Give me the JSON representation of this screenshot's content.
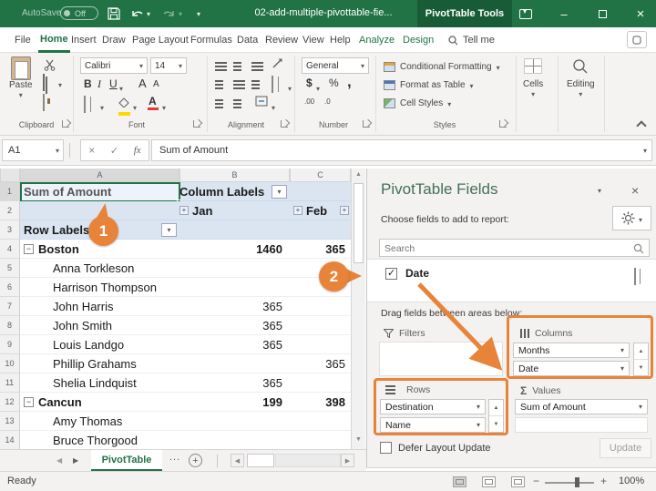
{
  "colors": {
    "excel_green": "#217346",
    "dark_green": "#185c37",
    "orange": "#e8833a",
    "header_blue": "#dbe5f1"
  },
  "titlebar": {
    "autosave_label": "AutoSave",
    "autosave_state": "Off",
    "filename": "02-add-multiple-pivottable-fie...",
    "context_tool": "PivotTable Tools"
  },
  "ribbon": {
    "tabs": [
      {
        "label": "File"
      },
      {
        "label": "Home",
        "active": true
      },
      {
        "label": "Insert"
      },
      {
        "label": "Draw"
      },
      {
        "label": "Page Layout"
      },
      {
        "label": "Formulas"
      },
      {
        "label": "Data"
      },
      {
        "label": "Review"
      },
      {
        "label": "View"
      },
      {
        "label": "Help"
      },
      {
        "label": "Analyze",
        "contextual": true
      },
      {
        "label": "Design",
        "contextual": true
      }
    ],
    "tell_me": "Tell me",
    "paste": "Paste",
    "font_name": "Calibri",
    "font_size": "14",
    "bold": "B",
    "italic": "I",
    "underline": "U",
    "grow_font": "A",
    "shrink_font": "A",
    "font_color_a": "A",
    "number_format": "General",
    "currency": "$",
    "percent": "%",
    "comma": ",",
    "inc_decimal": ".00",
    "dec_decimal": ".0",
    "cond_fmt": "Conditional Formatting",
    "fmt_table": "Format as Table",
    "cell_styles": "Cell Styles",
    "cells": "Cells",
    "editing": "Editing",
    "group_clipboard": "Clipboard",
    "group_font": "Font",
    "group_alignment": "Alignment",
    "group_number": "Number",
    "group_styles": "Styles"
  },
  "formula_bar": {
    "name_box": "A1",
    "fx": "fx",
    "value": "Sum of Amount"
  },
  "sheet": {
    "columns": [
      "A",
      "B",
      "C"
    ],
    "rows": [
      {
        "n": "1",
        "a": "Sum of Amount",
        "b": "Column Labels",
        "c": ""
      },
      {
        "n": "2",
        "a": "",
        "b": "Jan",
        "c": "Feb"
      },
      {
        "n": "3",
        "a": "Row Labels",
        "b": "",
        "c": ""
      },
      {
        "n": "4",
        "a": "Boston",
        "b": "1460",
        "c": "365"
      },
      {
        "n": "5",
        "a": "Anna Torkleson",
        "b": "",
        "c": ""
      },
      {
        "n": "6",
        "a": "Harrison Thompson",
        "b": "",
        "c": ""
      },
      {
        "n": "7",
        "a": "John Harris",
        "b": "365",
        "c": ""
      },
      {
        "n": "8",
        "a": "John Smith",
        "b": "365",
        "c": ""
      },
      {
        "n": "9",
        "a": "Louis Landgo",
        "b": "365",
        "c": ""
      },
      {
        "n": "10",
        "a": "Phillip Grahams",
        "b": "",
        "c": "365"
      },
      {
        "n": "11",
        "a": "Shelia Lindquist",
        "b": "365",
        "c": ""
      },
      {
        "n": "12",
        "a": "Cancun",
        "b": "199",
        "c": "398"
      },
      {
        "n": "13",
        "a": "Amy Thomas",
        "b": "",
        "c": ""
      },
      {
        "n": "14",
        "a": "Bruce Thorgood",
        "b": "",
        "c": ""
      }
    ],
    "collapse_glyph": "−",
    "expand_glyph": "+",
    "sheet_tab": "PivotTable",
    "more_sheets": "...",
    "status": "Ready",
    "zoom_level": "100%"
  },
  "pane": {
    "title": "PivotTable Fields",
    "subtitle": "Choose fields to add to report:",
    "search_placeholder": "Search",
    "fields": [
      {
        "label": "Date",
        "checked": true
      }
    ],
    "drag_hint": "Drag fields between areas below:",
    "filters_label": "Filters",
    "columns_label": "Columns",
    "rows_label": "Rows",
    "values_label": "Values",
    "columns_fields": [
      "Months",
      "Date"
    ],
    "rows_fields": [
      "Destination",
      "Name"
    ],
    "values_fields": [
      "Sum of Amount"
    ],
    "defer_label": "Defer Layout Update",
    "update_button": "Update"
  },
  "callouts": {
    "step1": "1",
    "step2": "2"
  }
}
